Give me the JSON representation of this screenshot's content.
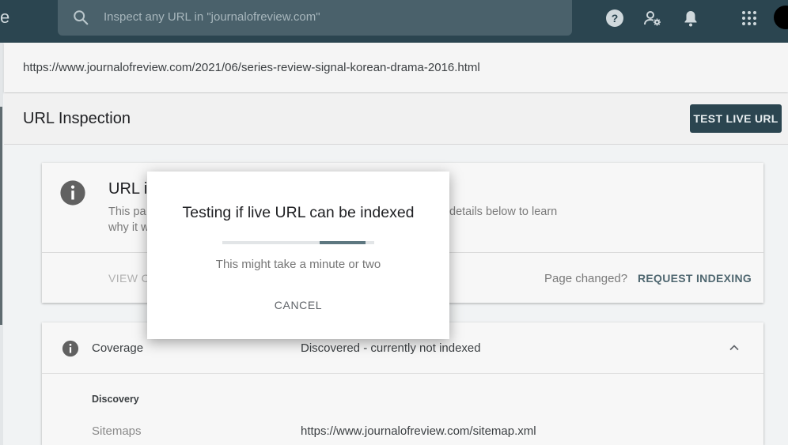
{
  "header": {
    "logo_fragment": "e",
    "search": {
      "placeholder": "Inspect any URL in \"journalofreview.com\""
    },
    "icons": [
      "search-icon",
      "help-icon",
      "manage-users-icon",
      "bell-icon",
      "apps-grid-icon",
      "avatar"
    ]
  },
  "inspected_url": "https://www.journalofreview.com/2021/06/series-review-signal-korean-drama-2016.html",
  "section": {
    "title": "URL Inspection",
    "test_live_label": "TEST LIVE URL"
  },
  "status_card": {
    "heading_visible": "URL is",
    "desc_line1_left": "This pa",
    "desc_line1_right": "details below to learn",
    "desc_line2_left": "why it w",
    "view_link": "VIEW C",
    "page_changed": "Page changed?",
    "request_indexing": "REQUEST INDEXING"
  },
  "coverage": {
    "label": "Coverage",
    "status": "Discovered - currently not indexed",
    "discovery_heading": "Discovery",
    "sitemaps_label": "Sitemaps",
    "sitemap_url": "https://www.journalofreview.com/sitemap.xml"
  },
  "dialog": {
    "title": "Testing if live URL can be indexed",
    "progress_fraction": 0.3,
    "message": "This might take a minute or two",
    "cancel_label": "CANCEL"
  },
  "colors": {
    "topbar": "#2b4550",
    "accent_button": "#2b4550",
    "progress": "#5d7780"
  }
}
